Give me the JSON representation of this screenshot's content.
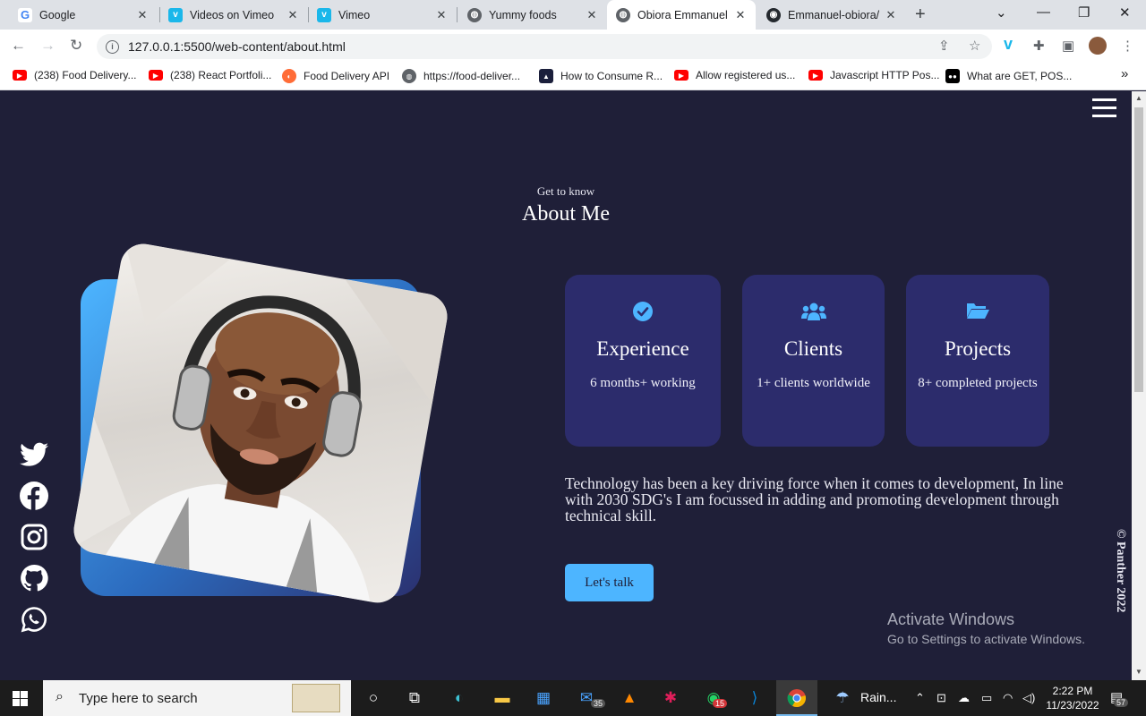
{
  "browser": {
    "tabs": [
      {
        "title": "Google",
        "favicon": "google-icon"
      },
      {
        "title": "Videos on Vimeo",
        "favicon": "vimeo-icon"
      },
      {
        "title": "Vimeo",
        "favicon": "vimeo-icon"
      },
      {
        "title": "Yummy foods",
        "favicon": "globe-icon"
      },
      {
        "title": "Obiora Emmanuel",
        "favicon": "globe-icon",
        "active": true
      },
      {
        "title": "Emmanuel-obiora/",
        "favicon": "github-icon"
      }
    ],
    "url": "127.0.0.1:5500/web-content/about.html",
    "bookmarks": [
      {
        "title": "(238) Food Delivery...",
        "favicon": "youtube-icon"
      },
      {
        "title": "(238) React Portfoli...",
        "favicon": "youtube-icon"
      },
      {
        "title": "Food Delivery API",
        "favicon": "postman-icon"
      },
      {
        "title": "https://food-deliver...",
        "favicon": "globe-icon"
      },
      {
        "title": "How to Consume R...",
        "favicon": "dev-icon"
      },
      {
        "title": "Allow registered us...",
        "favicon": "youtube-icon"
      },
      {
        "title": "Javascript HTTP Pos...",
        "favicon": "youtube-icon"
      },
      {
        "title": "What are GET, POS...",
        "favicon": "medium-icon"
      }
    ],
    "more_bookmarks": "»"
  },
  "page": {
    "kicker": "Get to know",
    "heading": "About Me",
    "cards": [
      {
        "icon": "check-circle-icon",
        "title": "Experience",
        "text": "6 months+ working"
      },
      {
        "icon": "users-icon",
        "title": "Clients",
        "text": "1+ clients worldwide"
      },
      {
        "icon": "folder-open-icon",
        "title": "Projects",
        "text": "8+ completed projects"
      }
    ],
    "about": "Technology has been a key driving force when it comes to development, In line with 2030 SDG's I am focussed in adding and promoting development through technical skill.",
    "cta_label": "Let's talk",
    "socials": [
      "twitter-icon",
      "facebook-icon",
      "instagram-icon",
      "github-icon",
      "whatsapp-icon"
    ],
    "copyright": "© Panther 2022",
    "activate_title": "Activate Windows",
    "activate_sub": "Go to Settings to activate Windows."
  },
  "colors": {
    "background": "#1f1f38",
    "card": "#2c2c6c",
    "accent": "#4db5ff"
  },
  "taskbar": {
    "search_placeholder": "Type here to search",
    "weather": "Rain...",
    "time": "2:22 PM",
    "date": "11/23/2022",
    "mail_badge": "35",
    "whatsapp_badge": "15",
    "notifications": "57"
  }
}
